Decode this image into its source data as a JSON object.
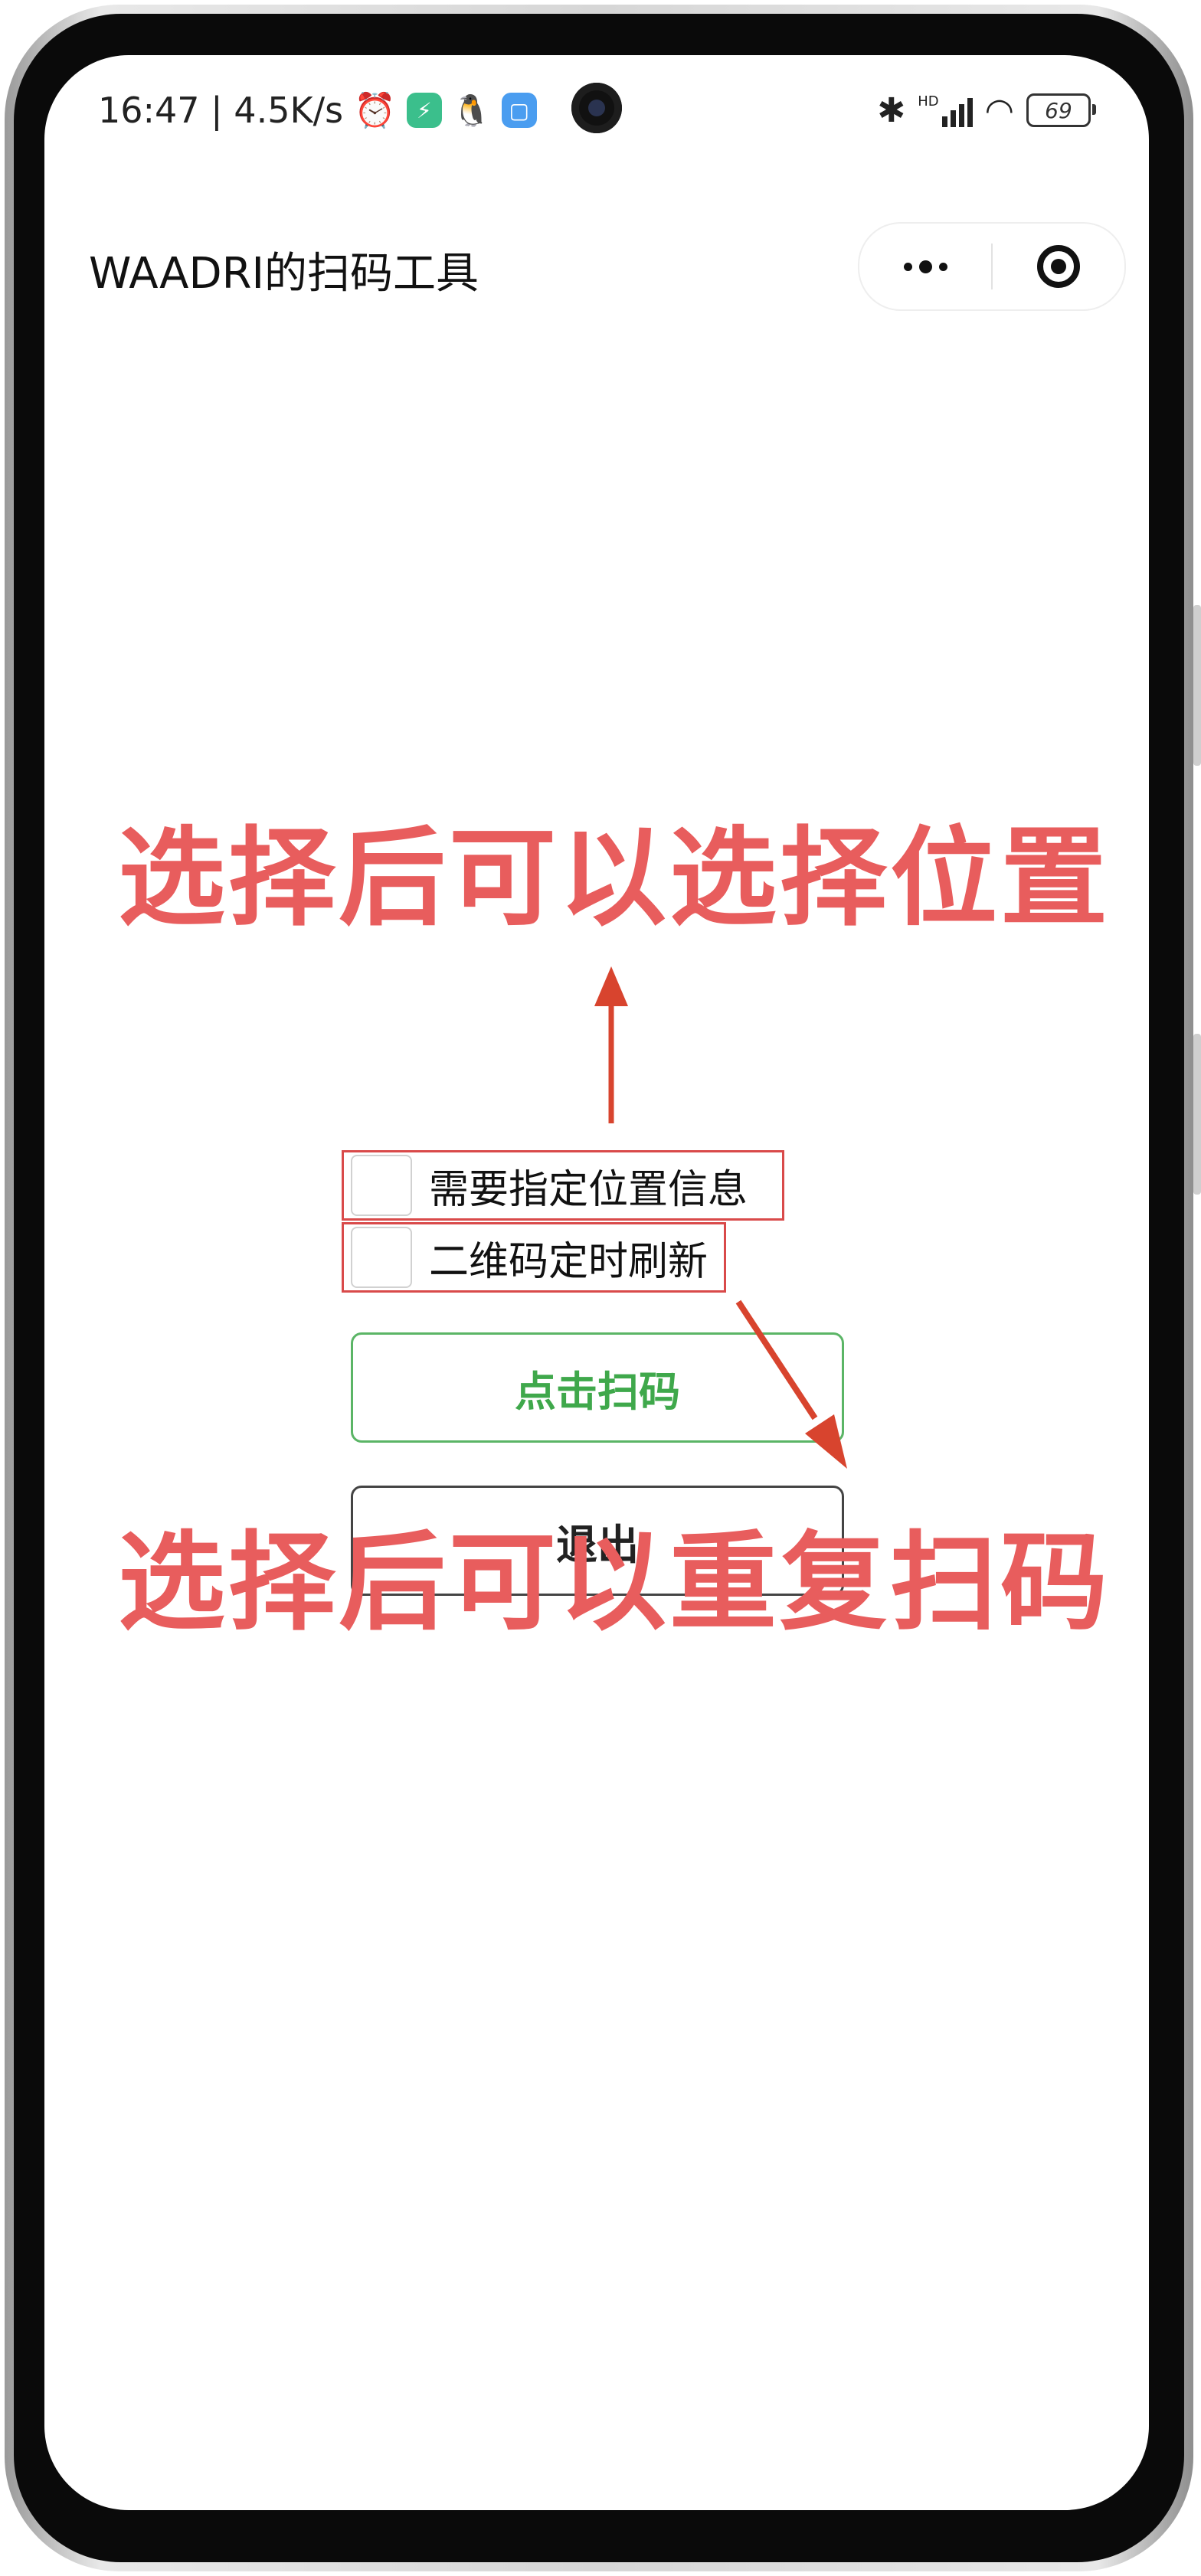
{
  "status_bar": {
    "time_speed": "16:47 | 4.5K/s",
    "alarm_icon": "alarm-clock-icon",
    "network_label": "HD",
    "battery_level": "69"
  },
  "navbar": {
    "title": "WAADRI的扫码工具",
    "more_icon": "more-dots-icon",
    "close_icon": "target-circle-icon"
  },
  "options": {
    "location_label": "需要指定位置信息",
    "refresh_label": "二维码定时刷新"
  },
  "buttons": {
    "scan_label": "点击扫码",
    "exit_label": "退出"
  },
  "annotations": {
    "top_text": "选择后可以选择位置",
    "bottom_text": "选择后可以重复扫码",
    "color": "#e85d5d"
  },
  "colors": {
    "scan_button": "#3fa84b",
    "highlight_box": "#d94a4a"
  }
}
